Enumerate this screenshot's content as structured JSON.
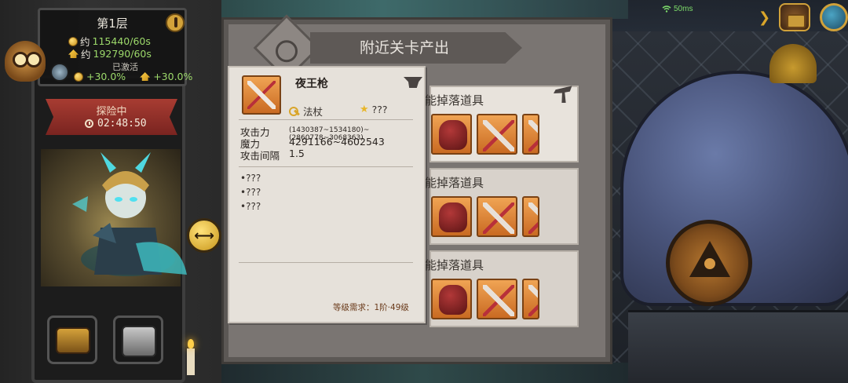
{
  "hud": {
    "ping": "50ms"
  },
  "floor_panel": {
    "title": "第1层",
    "gold_prefix": "约",
    "gold_rate": "115440/60s",
    "exp_prefix": "约",
    "exp_rate": "192790/60s",
    "activated_label": "已激活",
    "gold_bonus": "+30.0%",
    "exp_bonus": "+30.0%"
  },
  "exploration": {
    "status": "探险中",
    "timer": "02:48:50"
  },
  "dialog": {
    "title": "附近关卡产出",
    "rows": [
      {
        "title": "能掉落道具"
      },
      {
        "title": "能掉落道具"
      },
      {
        "title": "能掉落道具"
      }
    ]
  },
  "item_detail": {
    "name": "夜王枪",
    "type": "法杖",
    "rarity": "???",
    "stats": [
      {
        "label": "攻击力",
        "value": "(1430387~1534180)~(2860778~3068363)"
      },
      {
        "label": "魔力",
        "value": "4291166~4602543"
      },
      {
        "label": "攻击间隔",
        "value": "1.5"
      }
    ],
    "effects": [
      "•???",
      "•???",
      "•???"
    ],
    "level_requirement": "等级需求：1阶·49级"
  },
  "colors": {
    "accent_gold": "#d9a52a",
    "bonus_green": "#9cd86a",
    "banner_red": "#a83c32",
    "item_orange": "#e58a3a"
  },
  "icons": {
    "hud": [
      "wifi-icon",
      "arrow-right-icon",
      "treasure-chest-icon",
      "globe-icon"
    ],
    "panel": [
      "owl-icon",
      "coin-icon",
      "exp-icon",
      "clock-icon",
      "swap-icon",
      "candle-icon"
    ]
  }
}
